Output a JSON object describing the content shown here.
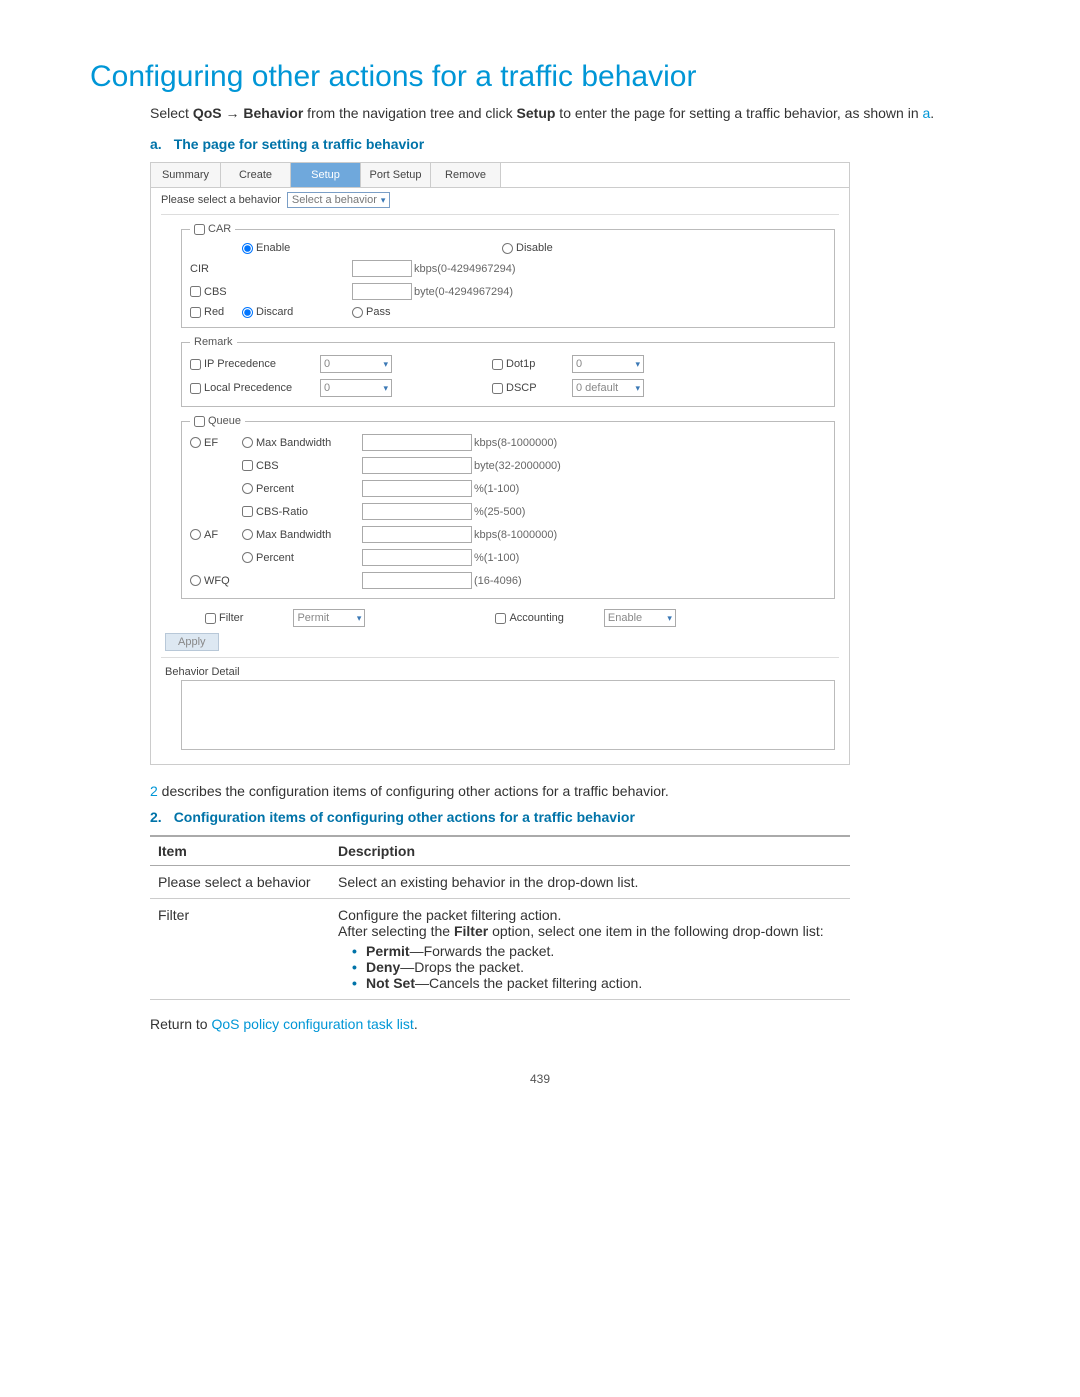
{
  "pageNumber": "439",
  "title": "Configuring other actions for a traffic behavior",
  "intro": {
    "pre": "Select ",
    "qos": "QoS",
    "arrow": " → ",
    "behavior": "Behavior",
    "mid": " from the navigation tree and click ",
    "setup": "Setup",
    "post": " to enter the page for setting a traffic behavior, as shown in ",
    "link": "a",
    "end": "."
  },
  "figA": {
    "label": "a.",
    "title": "The page for setting a traffic behavior"
  },
  "tabs": {
    "summary": "Summary",
    "create": "Create",
    "setup": "Setup",
    "portSetup": "Port Setup",
    "remove": "Remove"
  },
  "selectRow": {
    "label": "Please select a behavior",
    "placeholder": "Select a behavior"
  },
  "car": {
    "legend": "CAR",
    "enable": "Enable",
    "disable": "Disable",
    "cir": "CIR",
    "cirHint": "kbps(0-4294967294)",
    "cbs": "CBS",
    "cbsHint": "byte(0-4294967294)",
    "red": "Red",
    "discard": "Discard",
    "pass": "Pass"
  },
  "remark": {
    "legend": "Remark",
    "ipPrec": "IP Precedence",
    "ipPrecVal": "0",
    "localPrec": "Local Precedence",
    "localPrecVal": "0",
    "dot1p": "Dot1p",
    "dot1pVal": "0",
    "dscp": "DSCP",
    "dscpVal": "0 default"
  },
  "queue": {
    "legend": "Queue",
    "ef": "EF",
    "af": "AF",
    "wfq": "WFQ",
    "maxBw": "Max Bandwidth",
    "maxBwHint": "kbps(8-1000000)",
    "cbs": "CBS",
    "cbsHint": "byte(32-2000000)",
    "percent": "Percent",
    "percentHint": "%(1-100)",
    "cbsRatio": "CBS-Ratio",
    "cbsRatioHint": "%(25-500)",
    "wfqHint": "(16-4096)"
  },
  "filter": {
    "label": "Filter",
    "val": "Permit"
  },
  "accounting": {
    "label": "Accounting",
    "val": "Enable"
  },
  "apply": "Apply",
  "detailLabel": "Behavior Detail",
  "bodyP": {
    "pre": "",
    "link": "2",
    "post": " describes the configuration items of configuring other actions for a traffic behavior."
  },
  "tbl": {
    "label": "2.",
    "title": "Configuration items of configuring other actions for a traffic behavior",
    "h1": "Item",
    "h2": "Description",
    "r1i": "Please select a behavior",
    "r1d": "Select an existing behavior in the drop-down list.",
    "r2i": "Filter",
    "r2d1": "Configure the packet filtering action.",
    "r2d2a": "After selecting the ",
    "r2d2b": "Filter",
    "r2d2c": " option, select one item in the following drop-down list:",
    "r2li1a": "Permit",
    "r2li1b": "—Forwards the packet.",
    "r2li2a": "Deny",
    "r2li2b": "—Drops the packet.",
    "r2li3a": "Not Set",
    "r2li3b": "—Cancels the packet filtering action."
  },
  "returnText": "Return to ",
  "returnLink": "QoS policy configuration task list",
  "returnEnd": "."
}
